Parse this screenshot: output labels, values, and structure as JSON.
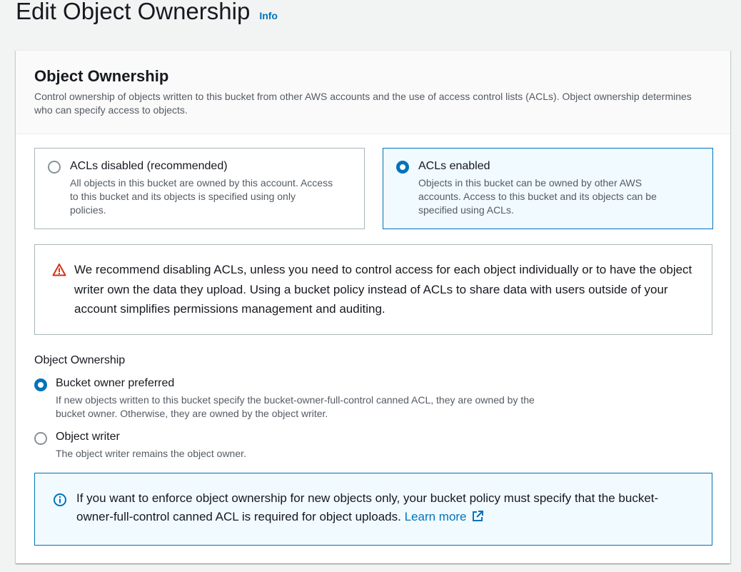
{
  "header": {
    "title": "Edit Object Ownership",
    "info_label": "Info"
  },
  "panel": {
    "title": "Object Ownership",
    "description": "Control ownership of objects written to this bucket from other AWS accounts and the use of access control lists (ACLs). Object ownership determines who can specify access to objects."
  },
  "acl_tiles": [
    {
      "label": "ACLs disabled (recommended)",
      "description": "All objects in this bucket are owned by this account. Access to this bucket and its objects is specified using only policies.",
      "selected": false
    },
    {
      "label": "ACLs enabled",
      "description": "Objects in this bucket can be owned by other AWS accounts. Access to this bucket and its objects can be specified using ACLs.",
      "selected": true
    }
  ],
  "warning": {
    "icon": "warning-icon",
    "text": "We recommend disabling ACLs, unless you need to control access for each object individually or to have the object writer own the data they upload. Using a bucket policy instead of ACLs to share data with users outside of your account simplifies permissions management and auditing."
  },
  "ownership": {
    "label": "Object Ownership",
    "options": [
      {
        "label": "Bucket owner preferred",
        "description": "If new objects written to this bucket specify the bucket-owner-full-control canned ACL, they are owned by the bucket owner. Otherwise, they are owned by the object writer.",
        "selected": true
      },
      {
        "label": "Object writer",
        "description": "The object writer remains the object owner.",
        "selected": false
      }
    ]
  },
  "info_alert": {
    "icon": "info-icon",
    "text": "If you want to enforce object ownership for new objects only, your bucket policy must specify that the bucket-owner-full-control canned ACL is required for object uploads.",
    "link_label": "Learn more",
    "link_icon": "external-link-icon"
  },
  "colors": {
    "accent": "#0073bb",
    "warning": "#d13212",
    "selected_bg": "#f1faff"
  }
}
